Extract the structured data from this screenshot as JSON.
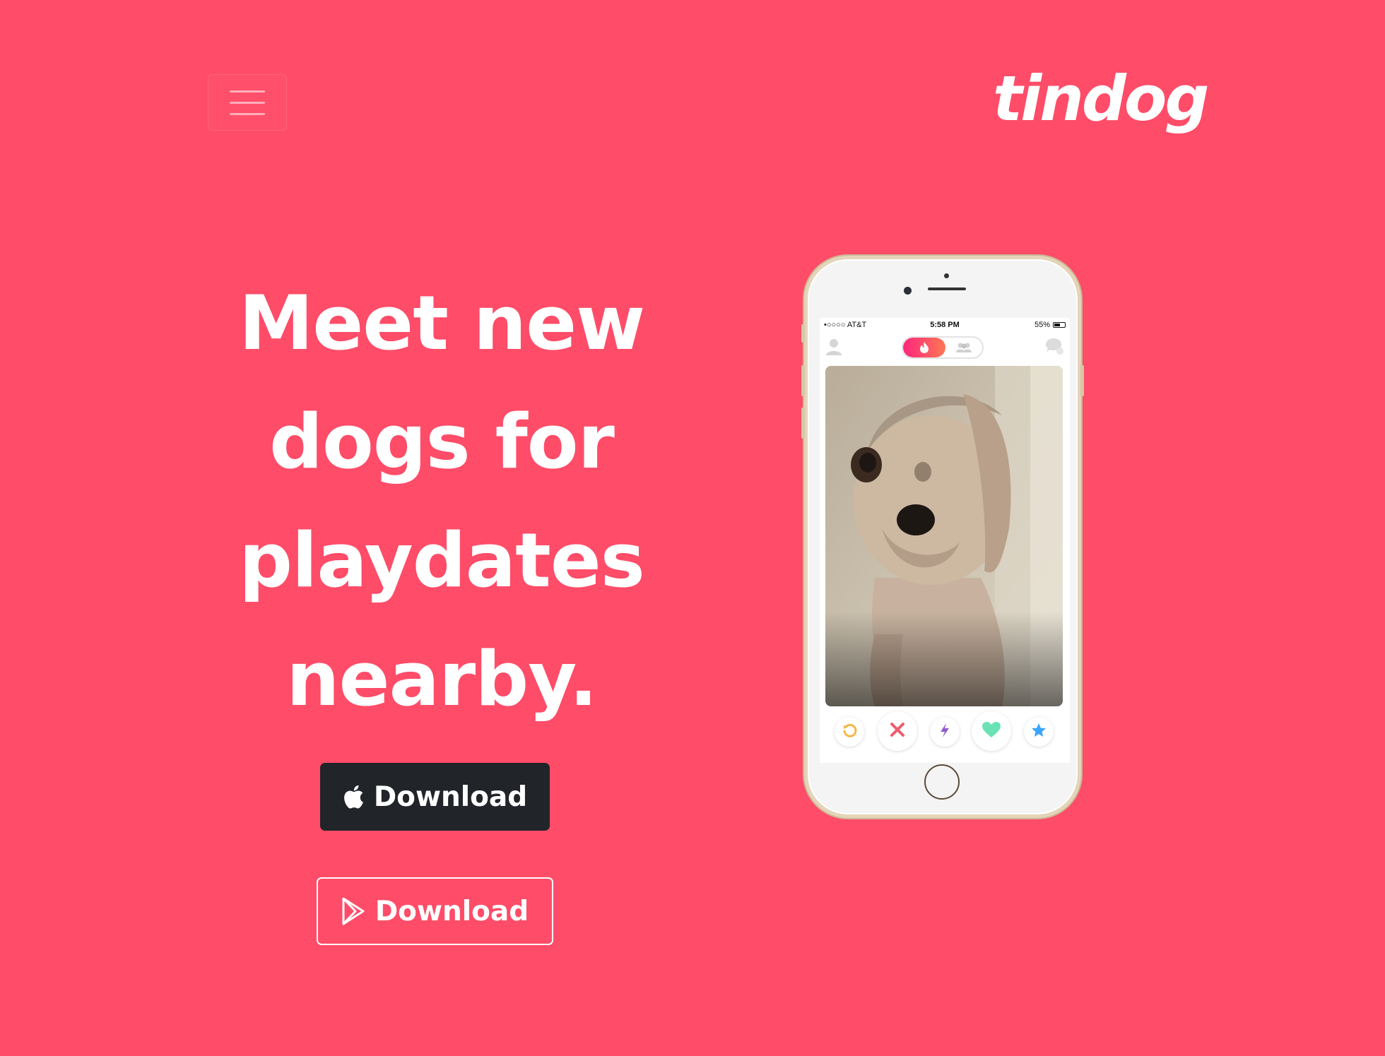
{
  "page": {
    "background_color": "#ff4c68"
  },
  "navbar": {
    "toggle_icon": "hamburger-menu-icon",
    "brand": "tindog"
  },
  "hero": {
    "title_lines": [
      "Meet new",
      "dogs for",
      "playdates",
      "nearby."
    ],
    "buttons": [
      {
        "label": "Download",
        "icon": "apple-icon",
        "style": "dark"
      },
      {
        "label": "Download",
        "icon": "google-play-icon",
        "style": "outline"
      }
    ]
  },
  "phone": {
    "status_bar": {
      "carrier": "•○○○○ AT&T",
      "time": "5:58 PM",
      "battery": "55%"
    },
    "toggle_icons": [
      "flame-icon",
      "group-icon"
    ],
    "header_icons": [
      "profile-icon",
      "chat-icon"
    ],
    "actions": [
      {
        "name": "rewind",
        "icon": "rewind-icon",
        "color": "#f5b748"
      },
      {
        "name": "nope",
        "icon": "close-icon",
        "color": "#ec5e6f"
      },
      {
        "name": "boost",
        "icon": "lightning-icon",
        "color": "#915dd1"
      },
      {
        "name": "like",
        "icon": "heart-icon",
        "color": "#6be2b5"
      },
      {
        "name": "super-like",
        "icon": "star-icon",
        "color": "#3ca4ff"
      }
    ]
  },
  "colors": {
    "brand_pink": "#ff4c68",
    "dark_button": "#212529",
    "white": "#ffffff"
  }
}
